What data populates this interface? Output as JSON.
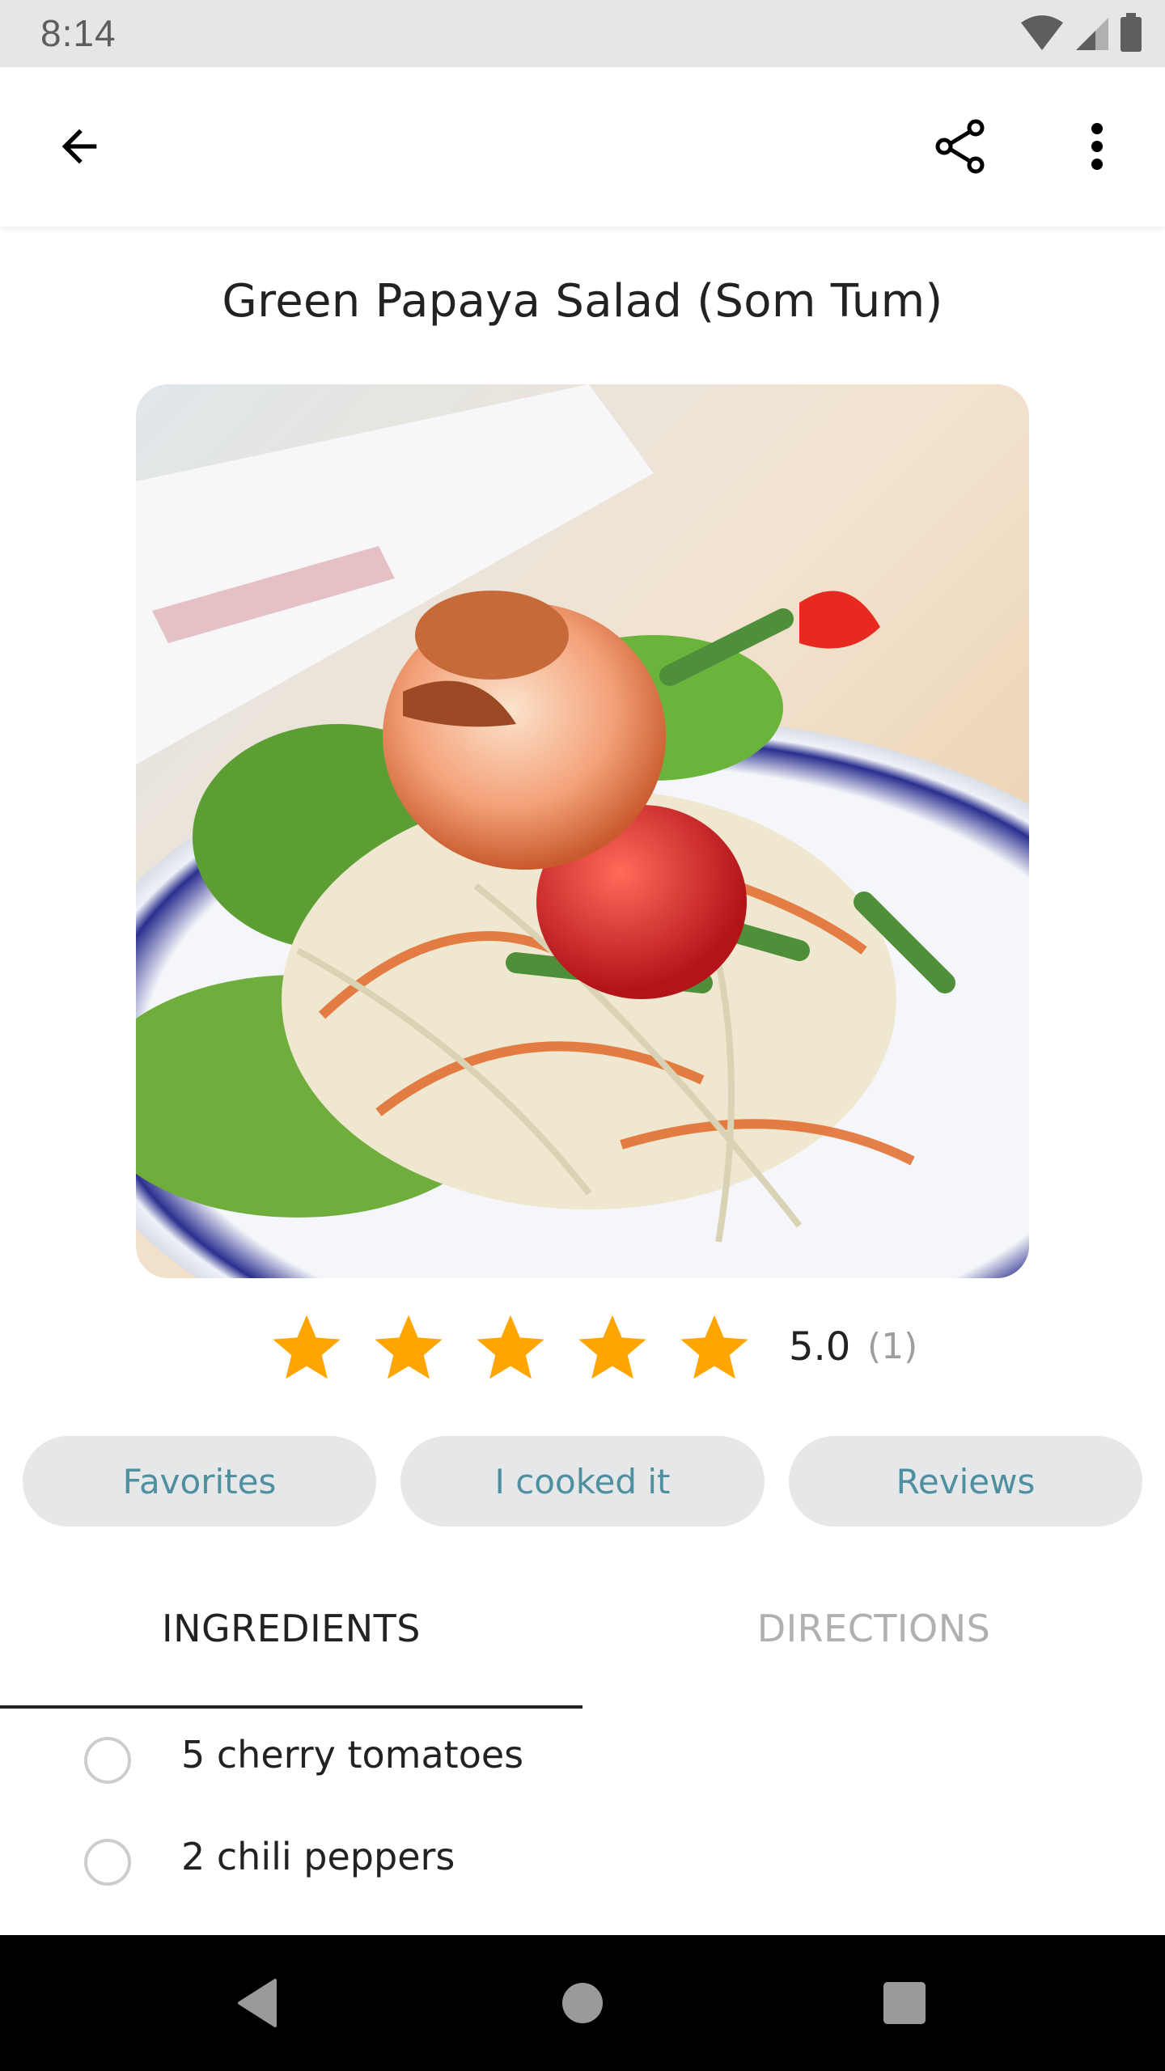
{
  "status_bar": {
    "time": "8:14",
    "icons": [
      "wifi-icon",
      "signal-icon",
      "battery-icon"
    ]
  },
  "app_bar": {
    "back_icon": "arrow-back-icon",
    "share_icon": "share-icon",
    "more_icon": "more-vert-icon"
  },
  "recipe": {
    "title": "Green Papaya Salad (Som Tum)",
    "photo_alt": "Green papaya salad with shrimp, cherry tomatoes and green beans on a blue and white plate",
    "rating": {
      "stars_filled": 5,
      "stars_total": 5,
      "value": "5.0",
      "count": "(1)",
      "star_color": "#FFA500"
    }
  },
  "actions": {
    "favorites": "Favorites",
    "cooked": "I cooked it",
    "reviews": "Reviews",
    "text_color": "#4E8FA0"
  },
  "tabs": [
    {
      "label": "INGREDIENTS",
      "active": true
    },
    {
      "label": "DIRECTIONS",
      "active": false
    }
  ],
  "ingredients": [
    {
      "text": "5 cherry tomatoes",
      "checked": false
    },
    {
      "text": "2 chili peppers",
      "checked": false
    }
  ],
  "nav_bar": {
    "back": "nav-back-icon",
    "home": "nav-home-icon",
    "recents": "nav-recents-icon"
  }
}
